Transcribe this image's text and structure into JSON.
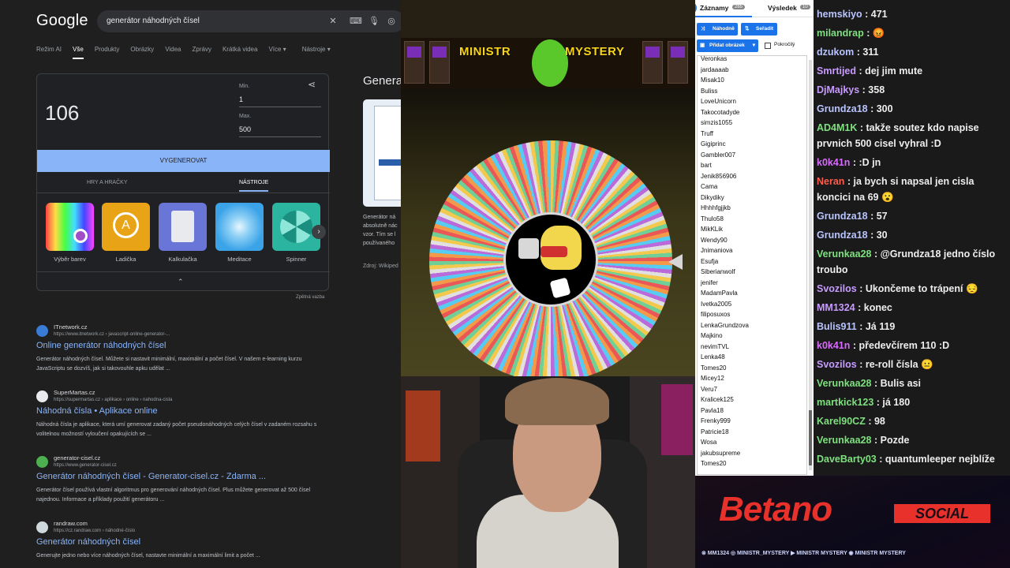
{
  "google": {
    "logo": "Google",
    "search_query": "generátor náhodných čísel",
    "tabs": [
      "Režim AI",
      "Vše",
      "Produkty",
      "Obrázky",
      "Videa",
      "Zprávy",
      "Krátká videa",
      "Více ▾",
      "Nástroje ▾"
    ],
    "active_tab": "Vše",
    "widget": {
      "result": "106",
      "min_label": "Min.",
      "min_value": "1",
      "max_label": "Max.",
      "max_value": "500",
      "generate_label": "VYGENEROVAT",
      "subtab_games": "HRY A HRAČKY",
      "subtab_tools": "NÁSTROJE",
      "tools": [
        "Výběr barev",
        "Ladička",
        "Kalkulačka",
        "Meditace",
        "Spinner"
      ],
      "feedback": "Zpětná vazba"
    },
    "knowledge": {
      "title": "Genera",
      "text": "Generátor ná absolutně nác vzor. Tím se l používaného",
      "source": "Zdroj: Wikiped"
    },
    "results": [
      {
        "site": "ITnetwork.cz",
        "url": "https://www.itnetwork.cz › javascript-online-generator-...",
        "title": "Online generátor náhodných čísel",
        "snippet": "Generátor náhodných čísel. Můžete si nastavit minimální, maximální a počet čísel. V našem e-learning kurzu JavaScriptu se dozvíš, jak si takovouhle apku udělat ..."
      },
      {
        "site": "SuperMartas.cz",
        "url": "https://supermartas.cz › aplikace › online › nahodna-cisla",
        "title": "Náhodná čísla • Aplikace online",
        "snippet": "Náhodná čísla je aplikace, která umí generovat zadaný počet pseudonáhodných celých čísel v zadaném rozsahu s volitelnou možností vyloučení opakujících se ..."
      },
      {
        "site": "generator-cisel.cz",
        "url": "https://www.generator-cisel.cz",
        "title": "Generátor náhodných čísel - Generator-cisel.cz - Zdarma ...",
        "snippet": "Generátor čísel používá vlastní algoritmus pro generování náhodných čísel. Plus můžete generovat až 500 čísel najednou. Informace a příklady použití generátoru ..."
      },
      {
        "site": "randraw.com",
        "url": "https://cz.randraw.com › náhodné-číslo",
        "title": "Generátor náhodných čísel",
        "snippet": "Generujte jedno nebo více náhodných čísel, nastavte minimální a maximální limit a počet ..."
      }
    ]
  },
  "banner": {
    "left": "MINISTR",
    "right": "MYSTERY"
  },
  "wheel": {
    "colors": [
      "#f2c94c",
      "#6fcf97",
      "#eb5757",
      "#f2994a",
      "#56ccf2",
      "#bb6bd9",
      "#e0e0e0"
    ]
  },
  "panel": {
    "tab_entries": "Záznamy",
    "entries_count": "265",
    "tab_result": "Výsledek",
    "result_count": "10",
    "btn_random": "Náhodně",
    "btn_sort": "Seřadit",
    "btn_image": "Přidat obrázek",
    "advanced": "Pokročilý",
    "entries": [
      "Veronkas",
      "jardaaaab",
      "Misak10",
      "Buliss",
      "LoveUnicorn",
      "Takocotadyde",
      "simzis1055",
      "Truff",
      "Gigiprinc",
      "Gambler007",
      "bart",
      "Jenik856906",
      "Cama",
      "Dikydiky",
      "Hhhhfgjjkb",
      "Thulo58",
      "MikKLik",
      "Wendy90",
      "Jnimaniova",
      "Esufja",
      "Siberianwolf",
      "jenifer",
      "MadamPavla",
      "Ivetka2005",
      "filiposuxos",
      "LenkaGrundzova",
      "Majkino",
      "nevimTVL",
      "Lenka48",
      "Tomes20",
      "Micey12",
      "Veru7",
      "Kralicek125",
      "Pavla18",
      "Frenky999",
      "Patricie18",
      "Wosa",
      "jakubsupreme",
      "Tomes20"
    ]
  },
  "chat": [
    {
      "user": "hemskiyo",
      "color": "#b9c4ff",
      "text": " : 471"
    },
    {
      "user": "milandrap",
      "color": "#7ee07e",
      "text": " : 😡"
    },
    {
      "user": "dzukom",
      "color": "#b9c4ff",
      "text": " : 311"
    },
    {
      "user": "Smrtijed",
      "color": "#c79bff",
      "text": " : dej jim mute"
    },
    {
      "user": "DjMajkys",
      "color": "#c79bff",
      "text": " : 358"
    },
    {
      "user": "Grundza18",
      "color": "#b9c4ff",
      "text": " : 300"
    },
    {
      "user": "AD4M1K",
      "color": "#7ee07e",
      "text": " : takže soutez kdo napise prvnich 500 cisel vyhral :D"
    },
    {
      "user": "k0k41n",
      "color": "#d96aff",
      "text": " : :D jn"
    },
    {
      "user": "Neran",
      "color": "#ff5c4d",
      "text": " : ja bych si napsal jen cisla koncici na 69 😮"
    },
    {
      "user": "Grundza18",
      "color": "#b9c4ff",
      "text": " : 57"
    },
    {
      "user": "Grundza18",
      "color": "#b9c4ff",
      "text": " : 30"
    },
    {
      "user": "Verunkaa28",
      "color": "#7ee07e",
      "text": " : @Grundza18 jedno číslo troubo"
    },
    {
      "user": "Svozilos",
      "color": "#c79bff",
      "text": " : Ukončeme to trápení 😔"
    },
    {
      "user": "MM1324",
      "color": "#c79bff",
      "text": " : konec"
    },
    {
      "user": "Bulis911",
      "color": "#b9c4ff",
      "text": " : Já 119"
    },
    {
      "user": "k0k41n",
      "color": "#d96aff",
      "text": " : předevčírem 110 :D"
    },
    {
      "user": "Svozilos",
      "color": "#c79bff",
      "text": " : re-roll čísla 😐"
    },
    {
      "user": "Verunkaa28",
      "color": "#7ee07e",
      "text": " : Bulis asi"
    },
    {
      "user": "martkick123",
      "color": "#7ee07e",
      "text": " : já 180"
    },
    {
      "user": "Karel90CZ",
      "color": "#7ee07e",
      "text": " : 98"
    },
    {
      "user": "Verunkaa28",
      "color": "#7ee07e",
      "text": " : Pozde"
    },
    {
      "user": "DaveBarty03",
      "color": "#7ee07e",
      "text": " : quantumleeper nejblíže"
    }
  ],
  "sponsor": {
    "name": "Betano",
    "tag": "SOCIAL",
    "socials": "⊗ MM1324  ◎ MINISTR_MYSTERY  ▶ MINISTR MYSTERY  ◉ MINISTR MYSTERY"
  }
}
